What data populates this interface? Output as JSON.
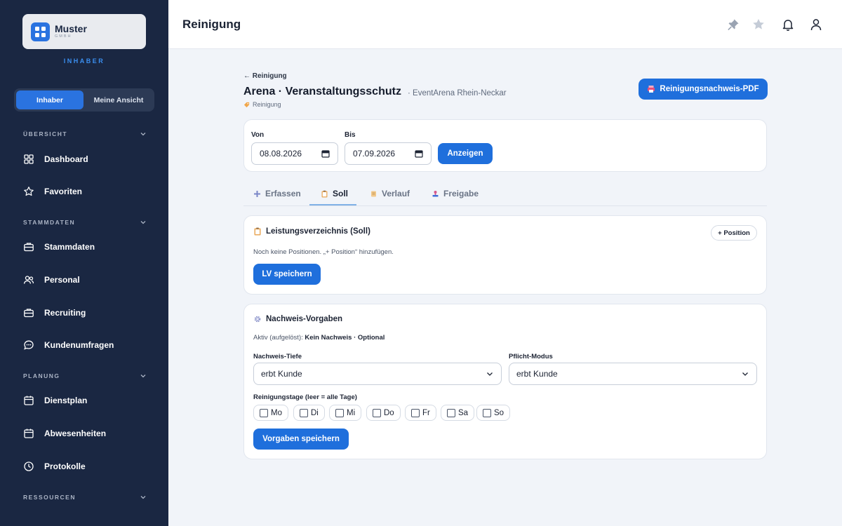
{
  "brand": {
    "name": "Muster",
    "sub": "GMBH",
    "role": "INHABER"
  },
  "view_toggle": {
    "options": [
      "Inhaber",
      "Meine Ansicht"
    ],
    "active": "Inhaber"
  },
  "sidebar": {
    "sections": [
      {
        "title": "ÜBERSICHT",
        "items": [
          "Dashboard",
          "Favoriten"
        ]
      },
      {
        "title": "STAMMDATEN",
        "items": [
          "Stammdaten",
          "Personal",
          "Recruiting",
          "Kundenumfragen"
        ]
      },
      {
        "title": "PLANUNG",
        "items": [
          "Dienstplan",
          "Abwesenheiten",
          "Protokolle"
        ]
      },
      {
        "title": "RESSOURCEN",
        "items": []
      }
    ]
  },
  "header": {
    "title": "Reinigung",
    "icons": [
      "pin-icon",
      "star-icon",
      "bell-icon",
      "user-icon"
    ]
  },
  "page": {
    "back_link": "← Reinigung",
    "title": "Arena · Veranstaltungsschutz",
    "subtitle": "· EventArena Rhein-Neckar",
    "tag": "Reinigung",
    "pdf_button": "Reinigungsnachweis-PDF"
  },
  "filter": {
    "from_label": "Von",
    "from_value": "08.08.2026",
    "to_label": "Bis",
    "to_value": "07.09.2026",
    "submit": "Anzeigen"
  },
  "tabs": [
    {
      "label": "Erfassen",
      "icon": "plus-icon"
    },
    {
      "label": "Soll",
      "icon": "clipboard-icon"
    },
    {
      "label": "Verlauf",
      "icon": "scroll-icon"
    },
    {
      "label": "Freigabe",
      "icon": "stamp-icon"
    }
  ],
  "active_tab": "Soll",
  "lv": {
    "title": "Leistungsverzeichnis (Soll)",
    "add_button": "+ Position",
    "empty": "Noch keine Positionen. „+ Position“ hinzufügen.",
    "save": "LV speichern"
  },
  "nachweis": {
    "title": "Nachweis-Vorgaben",
    "active_prefix": "Aktiv (aufgelöst):",
    "active_value": "Kein Nachweis · Optional",
    "depth_label": "Nachweis-Tiefe",
    "depth_value": "erbt Kunde",
    "mode_label": "Pflicht-Modus",
    "mode_value": "erbt Kunde",
    "days_label": "Reinigungstage (leer = alle Tage)",
    "days": [
      "Mo",
      "Di",
      "Mi",
      "Do",
      "Fr",
      "Sa",
      "So"
    ],
    "save": "Vorgaben speichern"
  },
  "colors": {
    "sidebar": "#1a2742",
    "accent": "#1f6fdc",
    "background": "#f1f4f9"
  }
}
